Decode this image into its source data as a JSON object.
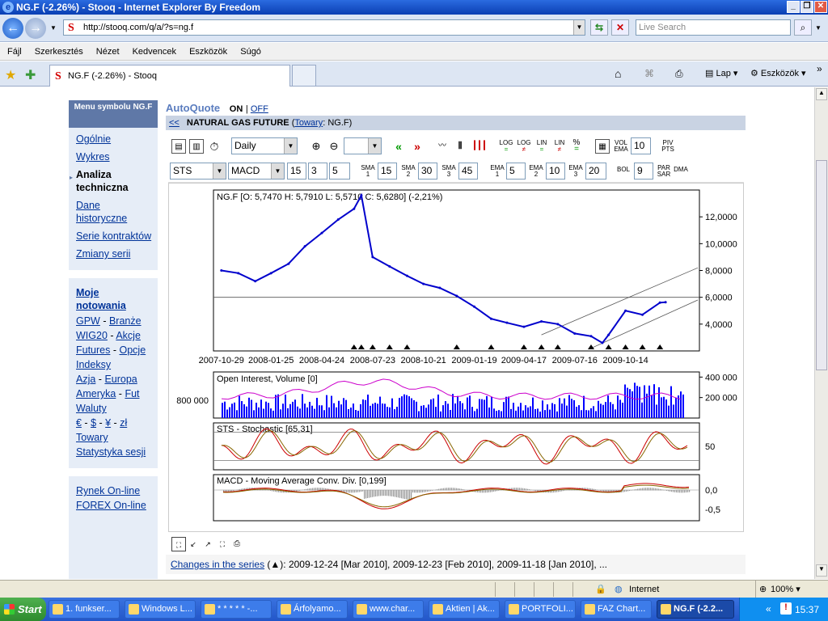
{
  "window": {
    "title": "NG.F (-2.26%) - Stooq - Internet Explorer By Freedom"
  },
  "addressbar": {
    "url": "http://stooq.com/q/a/?s=ng.f",
    "search_placeholder": "Live Search"
  },
  "menubar": {
    "items": [
      "Fájl",
      "Szerkesztés",
      "Nézet",
      "Kedvencek",
      "Eszközök",
      "Súgó"
    ]
  },
  "tabbar": {
    "tab_title": "NG.F (-2.26%) - Stooq",
    "lap": "Lap",
    "eszkozok": "Eszközök"
  },
  "sidebar": {
    "header": "Menu symbolu NG.F",
    "items": [
      "Ogólnie",
      "Wykres",
      "Analiza techniczna",
      "Dane historyczne",
      "Serie kontraktów",
      "Zmiany serii"
    ],
    "moje": "Moje notowania",
    "links": [
      "GPW",
      "Branże",
      "WIG20",
      "Akcje",
      "Futures",
      "Opcje",
      "Indeksy",
      "Azja",
      "Europa",
      "Ameryka",
      "Fut",
      "Waluty",
      "€",
      "$",
      "¥",
      "zł",
      "Towary",
      "Statystyka sesji"
    ],
    "online": [
      "Rynek On-line",
      "FOREX On-line"
    ]
  },
  "page": {
    "autoquote": "AutoQuote",
    "on": "ON",
    "off": "OFF",
    "back": "<<",
    "title": "NATURAL GAS FUTURE",
    "towary": "Towary",
    "symbol": ": NG.F)",
    "open_paren": "("
  },
  "toolbar": {
    "period": "Daily",
    "indicator1": "STS",
    "indicator2": "MACD",
    "params1": [
      "15",
      "3",
      "5"
    ],
    "sma_labels": [
      "SMA 1",
      "SMA 2",
      "SMA 3"
    ],
    "sma_values": [
      "15",
      "30",
      "45"
    ],
    "ema_labels": [
      "EMA 1",
      "EMA 2",
      "EMA 3"
    ],
    "ema_values": [
      "5",
      "10",
      "20"
    ],
    "vol_ema": "VOL EMA",
    "vol_value": "10",
    "piv": "PIV PTS",
    "bol": "BOL",
    "bol_value": "9",
    "parsar": "PAR SAR",
    "dma": "DMA",
    "log_labels": [
      "LOG",
      "LOG",
      "LIN",
      "LIN",
      "%"
    ]
  },
  "chart_data": [
    {
      "type": "line",
      "title": "NG.F [O: 5,7470  H: 5,7910  L: 5,5710  C: 5,6280] (-2,21%)",
      "x_ticks": [
        "2007-10-29",
        "2008-01-25",
        "2008-04-24",
        "2008-07-23",
        "2008-10-21",
        "2009-01-19",
        "2009-04-17",
        "2009-07-16",
        "2009-10-14"
      ],
      "y_ticks": [
        "12,0000",
        "10,0000",
        "8,0000",
        "6,0000",
        "4,0000"
      ],
      "ylim": [
        2.0,
        14.0
      ],
      "x": [
        "2007-10-29",
        "2007-11-28",
        "2007-12-28",
        "2008-01-25",
        "2008-02-25",
        "2008-03-25",
        "2008-04-24",
        "2008-05-23",
        "2008-06-20",
        "2008-07-03",
        "2008-07-23",
        "2008-08-22",
        "2008-09-22",
        "2008-10-21",
        "2008-11-19",
        "2008-12-19",
        "2009-01-19",
        "2009-02-18",
        "2009-03-18",
        "2009-04-17",
        "2009-05-18",
        "2009-06-16",
        "2009-07-16",
        "2009-08-14",
        "2009-09-03",
        "2009-09-14",
        "2009-10-14",
        "2009-11-13",
        "2009-12-14",
        "2009-12-24"
      ],
      "close": [
        8.0,
        7.8,
        7.2,
        7.8,
        8.5,
        9.8,
        10.8,
        11.8,
        12.6,
        13.6,
        9.0,
        8.3,
        7.6,
        7.0,
        6.7,
        6.1,
        5.3,
        4.4,
        4.1,
        3.8,
        4.2,
        4.0,
        3.3,
        3.1,
        2.6,
        3.2,
        5.0,
        4.7,
        5.6,
        5.63
      ],
      "markers": [
        "2008-06-20",
        "2008-07-03",
        "2008-07-23",
        "2008-08-22",
        "2008-09-22",
        "2008-12-19",
        "2009-02-18",
        "2009-04-17",
        "2009-05-18",
        "2009-06-16",
        "2009-08-14",
        "2009-09-14",
        "2009-10-14",
        "2009-11-13",
        "2009-12-14"
      ]
    },
    {
      "type": "bar",
      "title": "Open Interest, Volume [0]",
      "y_ticks": [
        "400 000",
        "200 000"
      ],
      "left_label": "800 000",
      "ylim": [
        0,
        450000
      ]
    },
    {
      "type": "line",
      "title": "STS - Stochastic [65,31]",
      "y_ticks": [
        "50"
      ],
      "ylim": [
        0,
        100
      ]
    },
    {
      "type": "line",
      "title": "MACD - Moving Average Conv. Div. [0,199]",
      "y_ticks": [
        "0,0",
        "-0,5"
      ],
      "ylim": [
        -0.8,
        0.4
      ]
    }
  ],
  "changes": {
    "link": "Changes in the series",
    "text": " (▲): 2009-12-24 [Mar 2010], 2009-12-23 [Feb 2010], 2009-11-18 [Jan 2010], ..."
  },
  "statusbar": {
    "zone": "Internet",
    "zoom": "100%"
  },
  "taskbar": {
    "start": "Start",
    "items": [
      "1. funkser...",
      "Windows L...",
      "* * * * * -...",
      "Árfolyamo...",
      "www.char...",
      "Aktien | Ak...",
      "PORTFOLI...",
      "FAZ Chart...",
      "NG.F (-2.2..."
    ],
    "lang": "HU",
    "clock": "15:37"
  },
  "colors": {
    "price": "#0000cc",
    "volume": "#0000ff",
    "oi": "#cc00cc",
    "sto1": "#cc0000",
    "sto2": "#886600",
    "menuhead": "#5f78a7"
  }
}
